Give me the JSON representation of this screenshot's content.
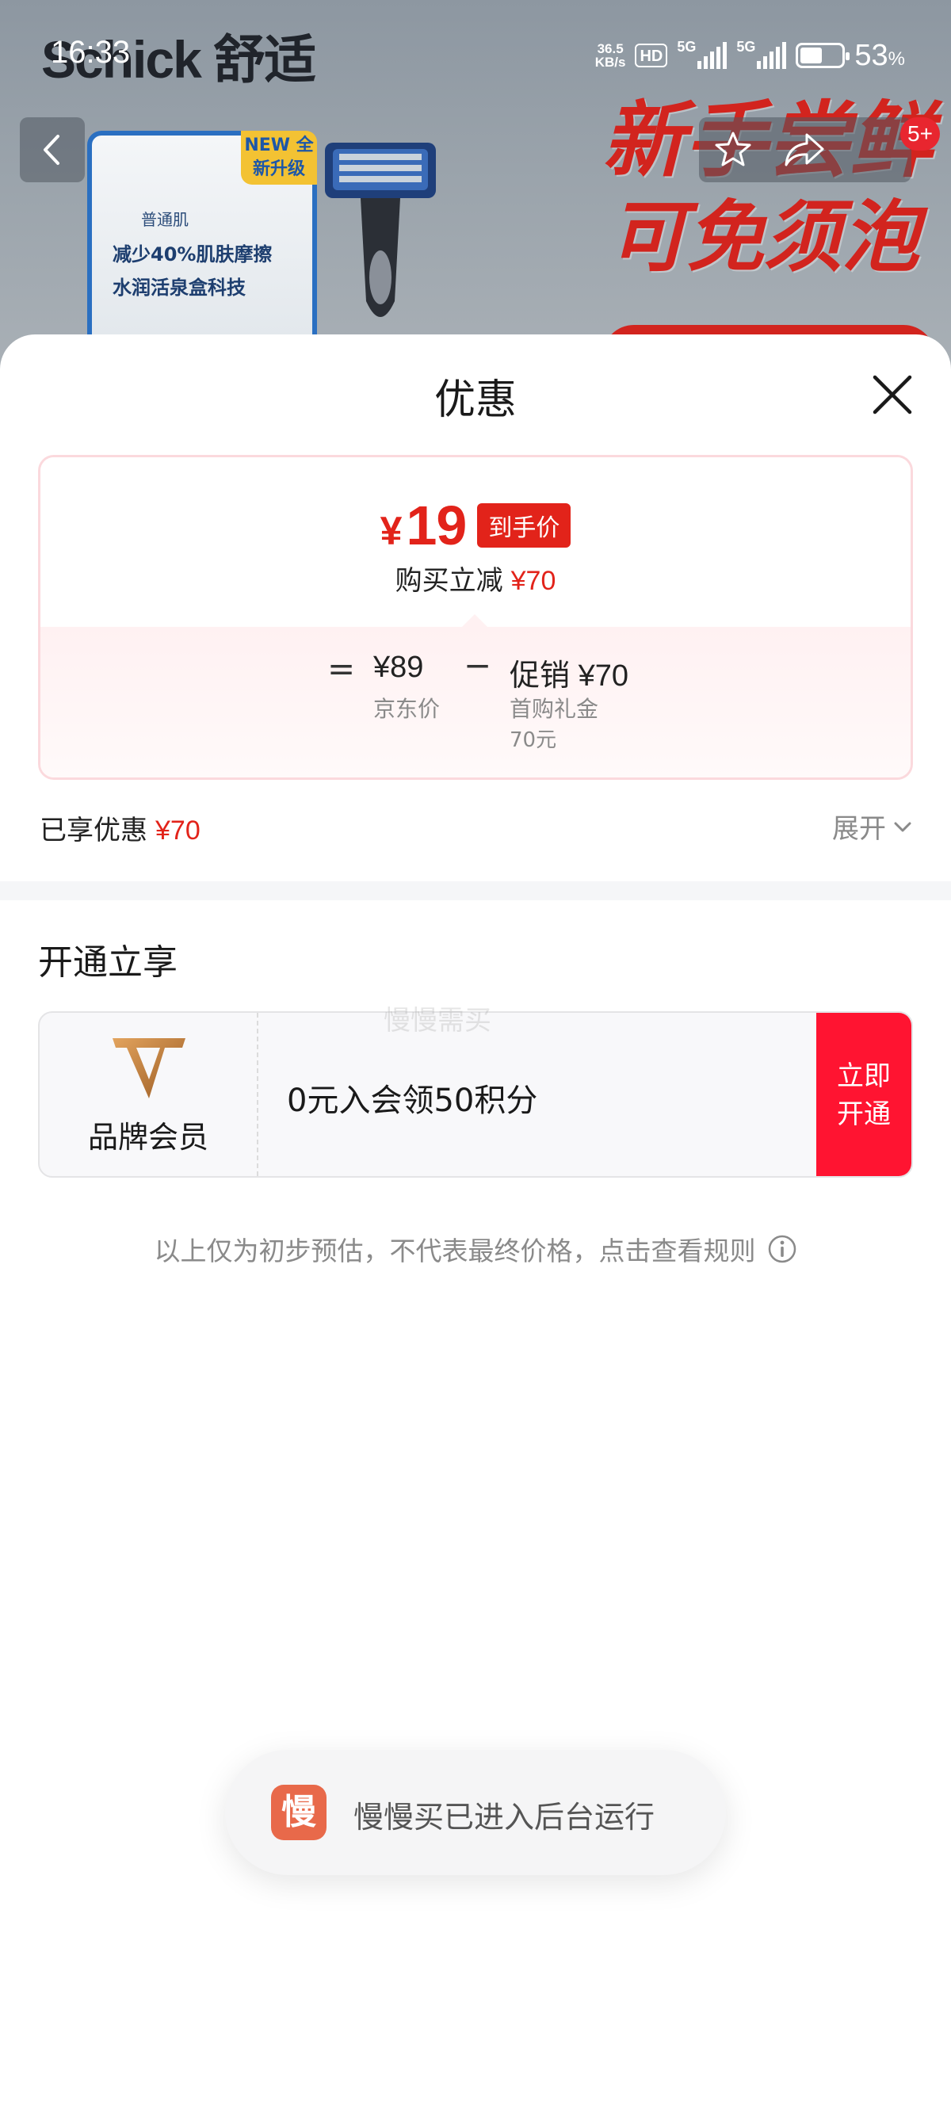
{
  "status_bar": {
    "time": "16:33",
    "net_speed_value": "36.5",
    "net_speed_unit": "KB/s",
    "hd_label": "HD",
    "signal_1_gen": "5G",
    "signal_2_gen": "5G",
    "battery_level": 0.53,
    "battery_pct": "53",
    "battery_unit": "%"
  },
  "banner": {
    "brand_logo": "Schick 舒适",
    "box_tag": "NEW 全新升级",
    "box_line1": "普通肌",
    "box_line2": "减少40%肌肤摩擦",
    "box_line3": "水润活泉盒科技",
    "slogan_line1": "新手尝鲜",
    "slogan_line2": "可免须泡"
  },
  "top_nav": {
    "back_icon": "chevron-left-icon",
    "favorite_icon": "star-icon",
    "share_icon": "share-icon",
    "badge": "5+"
  },
  "sheet": {
    "title": "优惠",
    "close_icon": "close-icon",
    "final_price": {
      "currency": "¥",
      "value": "19",
      "tag": "到手价"
    },
    "reduce_label": "购买立减",
    "reduce_amount": "¥70",
    "formula": {
      "equals": "=",
      "minus": "−",
      "base_value": "¥89",
      "base_label": "京东价",
      "promo_label": "促销",
      "promo_value": "¥70",
      "promo_sub1": "首购礼金",
      "promo_sub2": "70元"
    },
    "enjoyed_label": "已享优惠",
    "enjoyed_amount": "¥70",
    "expand_label": "展开",
    "section_title": "开通立享",
    "member": {
      "logo_icon": "v-brand-logo-icon",
      "label": "品牌会员",
      "description": "0元入会领50积分",
      "open_line1": "立即",
      "open_line2": "开通"
    },
    "watermark": "慢慢需买",
    "disclaimer": "以上仅为初步预估，不代表最终价格，点击查看规则",
    "info_icon": "info-icon"
  },
  "toast": {
    "app_icon_char": "慢",
    "message": "慢慢买已进入后台运行"
  },
  "colors": {
    "accent_red": "#e2231a",
    "open_button_red": "#ff1431",
    "card_border_pink": "#fbd9dd",
    "toast_icon_orange": "#e8694a"
  }
}
